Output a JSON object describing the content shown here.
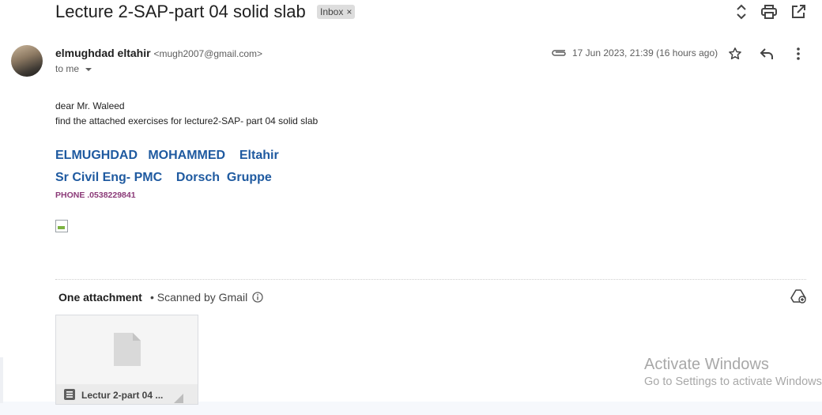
{
  "header": {
    "subject": "Lecture 2-SAP-part 04 solid slab",
    "label_chip": "Inbox",
    "label_remove": "×"
  },
  "message": {
    "sender_name": "elmughdad eltahir",
    "sender_email": "<mugh2007@gmail.com>",
    "to": "to me",
    "date": "17 Jun 2023, 21:39 (16 hours ago)",
    "body": [
      "dear Mr. Waleed",
      "find the attached exercises for lecture2-SAP- part 04 solid slab"
    ],
    "signature": {
      "line1": "ELMUGHDAD   MOHAMMED    Eltahir",
      "line2": "Sr Civil Eng- PMC    Dorsch  Gruppe",
      "phone": "PHONE .0538229841"
    }
  },
  "attachments": {
    "title": "One attachment",
    "scanned": "• Scanned by Gmail",
    "file_name": "Lectur 2-part 04 ..."
  },
  "watermark": {
    "title": "Activate Windows",
    "subtitle": "Go to Settings to activate Windows."
  },
  "icons": [
    "expand-icon",
    "print-icon",
    "open-new-window-icon",
    "attachment-icon",
    "star-icon",
    "reply-icon",
    "more-vert-icon",
    "info-icon",
    "add-to-drive-icon",
    "document-icon"
  ],
  "colors": {
    "signature": "#1f5aa0",
    "phone": "#8b3a78",
    "chip_bg": "#dddddd"
  }
}
